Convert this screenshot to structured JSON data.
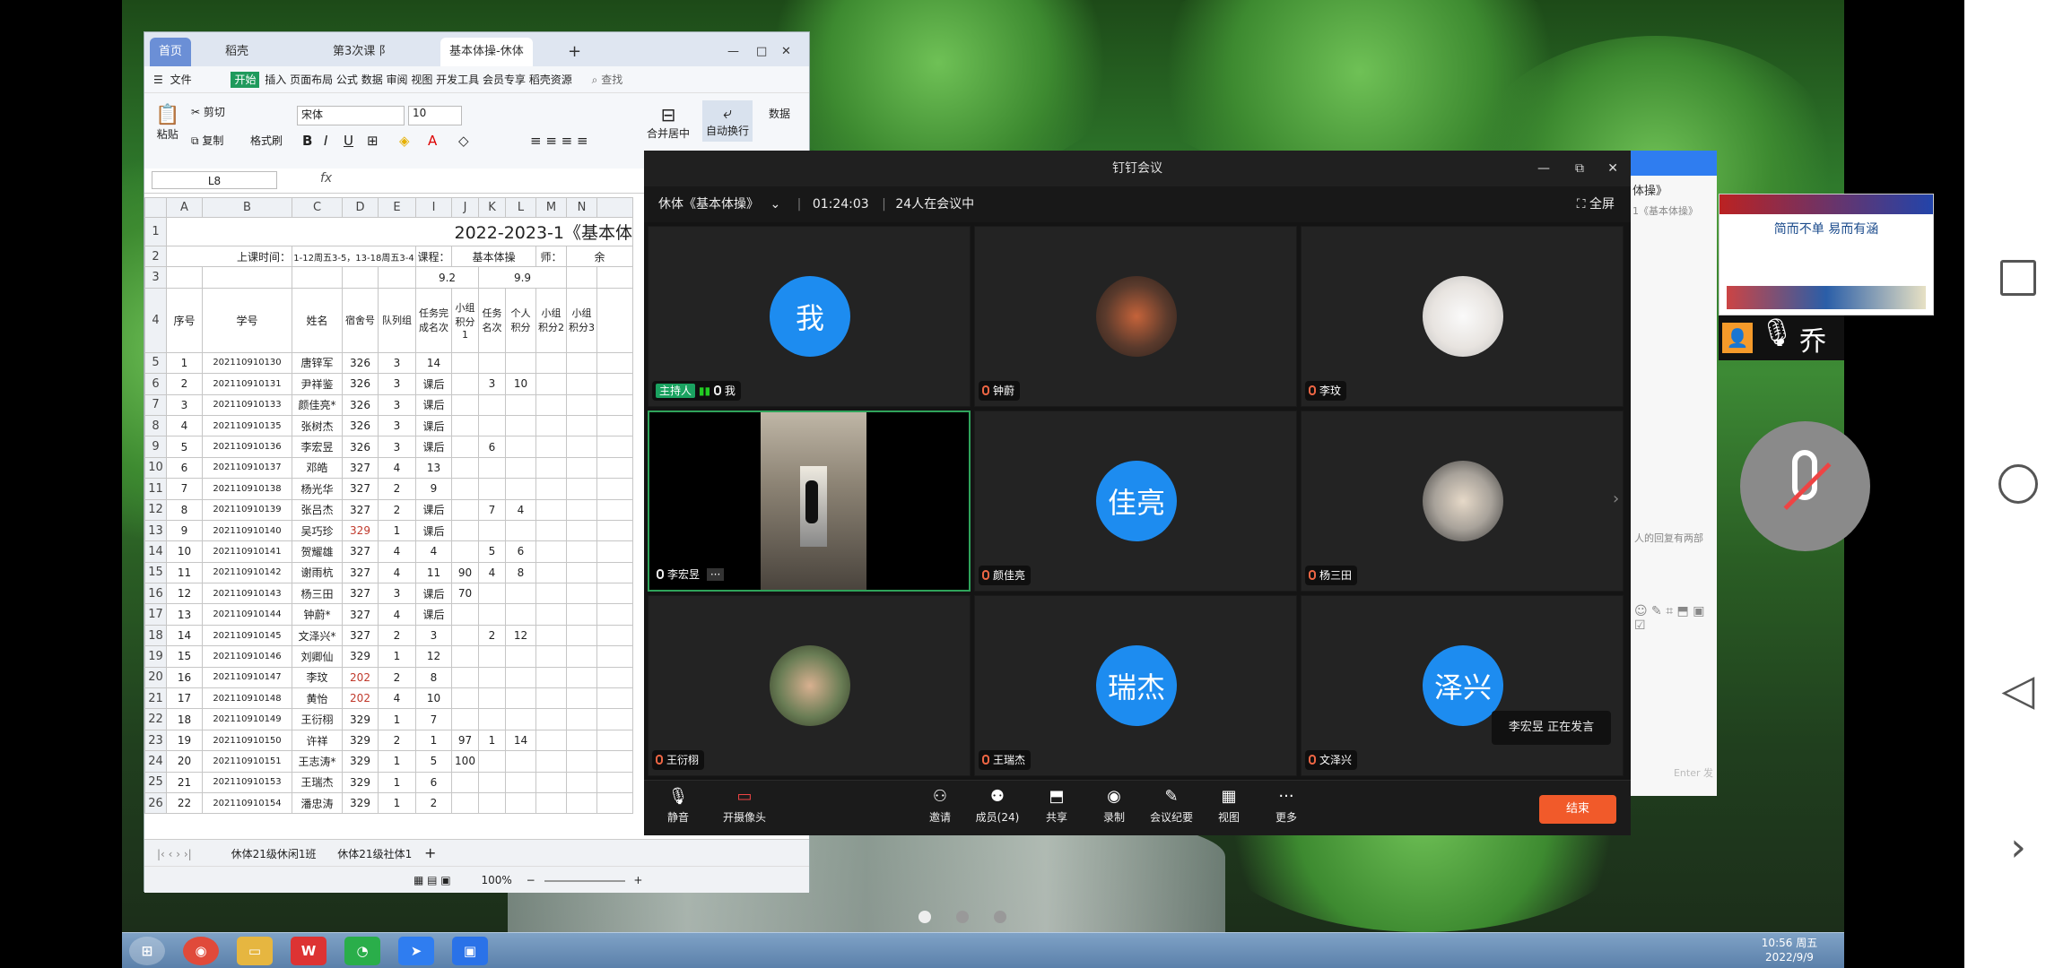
{
  "desktop": {
    "taskbar_clock_time": "10:56 周五",
    "taskbar_clock_date": "2022/9/9"
  },
  "sheet": {
    "tabs": [
      "首页",
      "稻壳",
      "第3次课 阝",
      "基本体操-休体"
    ],
    "menu": {
      "file": "文件",
      "start": "开始",
      "rest": "插入 页面布局 公式 数据 审阅 视图 开发工具 会员专享 稻壳资源",
      "search": "查找"
    },
    "ribbon": {
      "paste": "粘贴",
      "cut": "剪切",
      "copy": "复制",
      "format_painter": "格式刷",
      "font": "宋体",
      "size": "10",
      "merge": "合并居中",
      "wrap": "自动换行",
      "numformat": "数据"
    },
    "cell_ref": "L8",
    "fx": "fx",
    "col_letters": [
      "A",
      "B",
      "C",
      "D",
      "E",
      "I",
      "J",
      "K",
      "L",
      "M",
      "N"
    ],
    "title_row": "2022-2023-1《基本体",
    "row2": {
      "label": "上课时间：",
      "time": "1-12周五3-5，13-18周五3-4",
      "course_label": "课程：",
      "course": "基本体操",
      "teacher_label": "师：",
      "teacher": "余"
    },
    "row3": {
      "a": "9.2",
      "b": "9.9"
    },
    "headers": [
      "序号",
      "学号",
      "姓名",
      "宿舍号",
      "队列组",
      "任务完成名次",
      "小组积分1",
      "任务名次",
      "个人积分",
      "小组积分2",
      "小组积分3"
    ],
    "rows": [
      [
        "1",
        "202110910130",
        "唐锌军",
        "326",
        "3",
        "14",
        "",
        "",
        "",
        "",
        ""
      ],
      [
        "2",
        "202110910131",
        "尹祥鉴",
        "326",
        "3",
        "课后",
        "",
        "3",
        "10",
        "",
        ""
      ],
      [
        "3",
        "202110910133",
        "颜佳亮*",
        "326",
        "3",
        "课后",
        "",
        "",
        "",
        "",
        ""
      ],
      [
        "4",
        "202110910135",
        "张树杰",
        "326",
        "3",
        "课后",
        "",
        "",
        "",
        "",
        ""
      ],
      [
        "5",
        "202110910136",
        "李宏昱",
        "326",
        "3",
        "课后",
        "",
        "6",
        "",
        "",
        ""
      ],
      [
        "6",
        "202110910137",
        "邓皓",
        "327",
        "4",
        "13",
        "",
        "",
        "",
        "",
        ""
      ],
      [
        "7",
        "202110910138",
        "杨光华",
        "327",
        "2",
        "9",
        "",
        "",
        "",
        "",
        ""
      ],
      [
        "8",
        "202110910139",
        "张吕杰",
        "327",
        "2",
        "课后",
        "",
        "7",
        "4",
        "",
        ""
      ],
      [
        "9",
        "202110910140",
        "吴巧珍",
        "329",
        "1",
        "课后",
        "",
        "",
        "",
        "",
        ""
      ],
      [
        "10",
        "202110910141",
        "贺耀雄",
        "327",
        "4",
        "4",
        "",
        "5",
        "6",
        "",
        ""
      ],
      [
        "11",
        "202110910142",
        "谢雨杭",
        "327",
        "4",
        "11",
        "90",
        "4",
        "8",
        "",
        ""
      ],
      [
        "12",
        "202110910143",
        "杨三田",
        "327",
        "3",
        "课后",
        "70",
        "",
        "",
        "",
        ""
      ],
      [
        "13",
        "202110910144",
        "钟蔚*",
        "327",
        "4",
        "课后",
        "",
        "",
        "",
        "",
        ""
      ],
      [
        "14",
        "202110910145",
        "文泽兴*",
        "327",
        "2",
        "3",
        "",
        "2",
        "12",
        "",
        ""
      ],
      [
        "15",
        "202110910146",
        "刘卿仙",
        "329",
        "1",
        "12",
        "",
        "",
        "",
        "",
        ""
      ],
      [
        "16",
        "202110910147",
        "李玟",
        "202",
        "2",
        "8",
        "",
        "",
        "",
        "",
        ""
      ],
      [
        "17",
        "202110910148",
        "黄怡",
        "202",
        "4",
        "10",
        "",
        "",
        "",
        "",
        ""
      ],
      [
        "18",
        "202110910149",
        "王衍栩",
        "329",
        "1",
        "7",
        "",
        "",
        "",
        "",
        ""
      ],
      [
        "19",
        "202110910150",
        "许祥",
        "329",
        "2",
        "1",
        "97",
        "1",
        "14",
        "",
        ""
      ],
      [
        "20",
        "202110910151",
        "王志涛*",
        "329",
        "1",
        "5",
        "100",
        "",
        "",
        "",
        ""
      ],
      [
        "21",
        "202110910153",
        "王瑞杰",
        "329",
        "1",
        "6",
        "",
        "",
        "",
        "",
        ""
      ],
      [
        "22",
        "202110910154",
        "潘忠涛",
        "329",
        "1",
        "2",
        "",
        "",
        "",
        "",
        ""
      ]
    ],
    "row_numbers": [
      "5",
      "6",
      "7",
      "8",
      "9",
      "10",
      "11",
      "12",
      "13",
      "14",
      "15",
      "16",
      "17",
      "18",
      "19",
      "20",
      "21",
      "22",
      "23",
      "24",
      "25",
      "26"
    ],
    "sheet_tabs": [
      "休体21级休闲1班",
      "休体21级社体1"
    ],
    "zoom": "100%"
  },
  "meeting": {
    "title": "钉钉会议",
    "name": "休体《基本体操》",
    "timer": "01:24:03",
    "count": "24人在会议中",
    "fullscreen": "全屏",
    "host_tag": "主持人",
    "tiles": [
      {
        "name": "我",
        "avatar": "我",
        "type": "text"
      },
      {
        "name": "钟蔚",
        "type": "photo",
        "color": "#5a3a2c"
      },
      {
        "name": "李玟",
        "type": "photo",
        "color": "#e8e4e0"
      },
      {
        "name": "李宏昱",
        "type": "video"
      },
      {
        "name": "颜佳亮",
        "avatar": "佳亮",
        "type": "text"
      },
      {
        "name": "杨三田",
        "type": "photo",
        "color": "#a8a29a"
      },
      {
        "name": "王衍栩",
        "type": "photo",
        "color": "#6a7d55"
      },
      {
        "name": "王瑞杰",
        "avatar": "瑞杰",
        "type": "text"
      },
      {
        "name": "文泽兴",
        "avatar": "泽兴",
        "type": "text"
      }
    ],
    "speaking_name": "李宏昱",
    "speaking_text": "正在发言",
    "toolbar": [
      "静音",
      "开摄像头",
      "邀请",
      "成员(24)",
      "共享",
      "录制",
      "会议纪要",
      "视图",
      "更多"
    ],
    "end": "结束"
  },
  "side": {
    "panel_title": "体操》",
    "panel_sub": "1《基本体操》",
    "panel_note": "人的回复有两部",
    "panel_enter": "Enter 发",
    "ppt_text": "简而不单 易而有涵",
    "presenter": "乔"
  }
}
